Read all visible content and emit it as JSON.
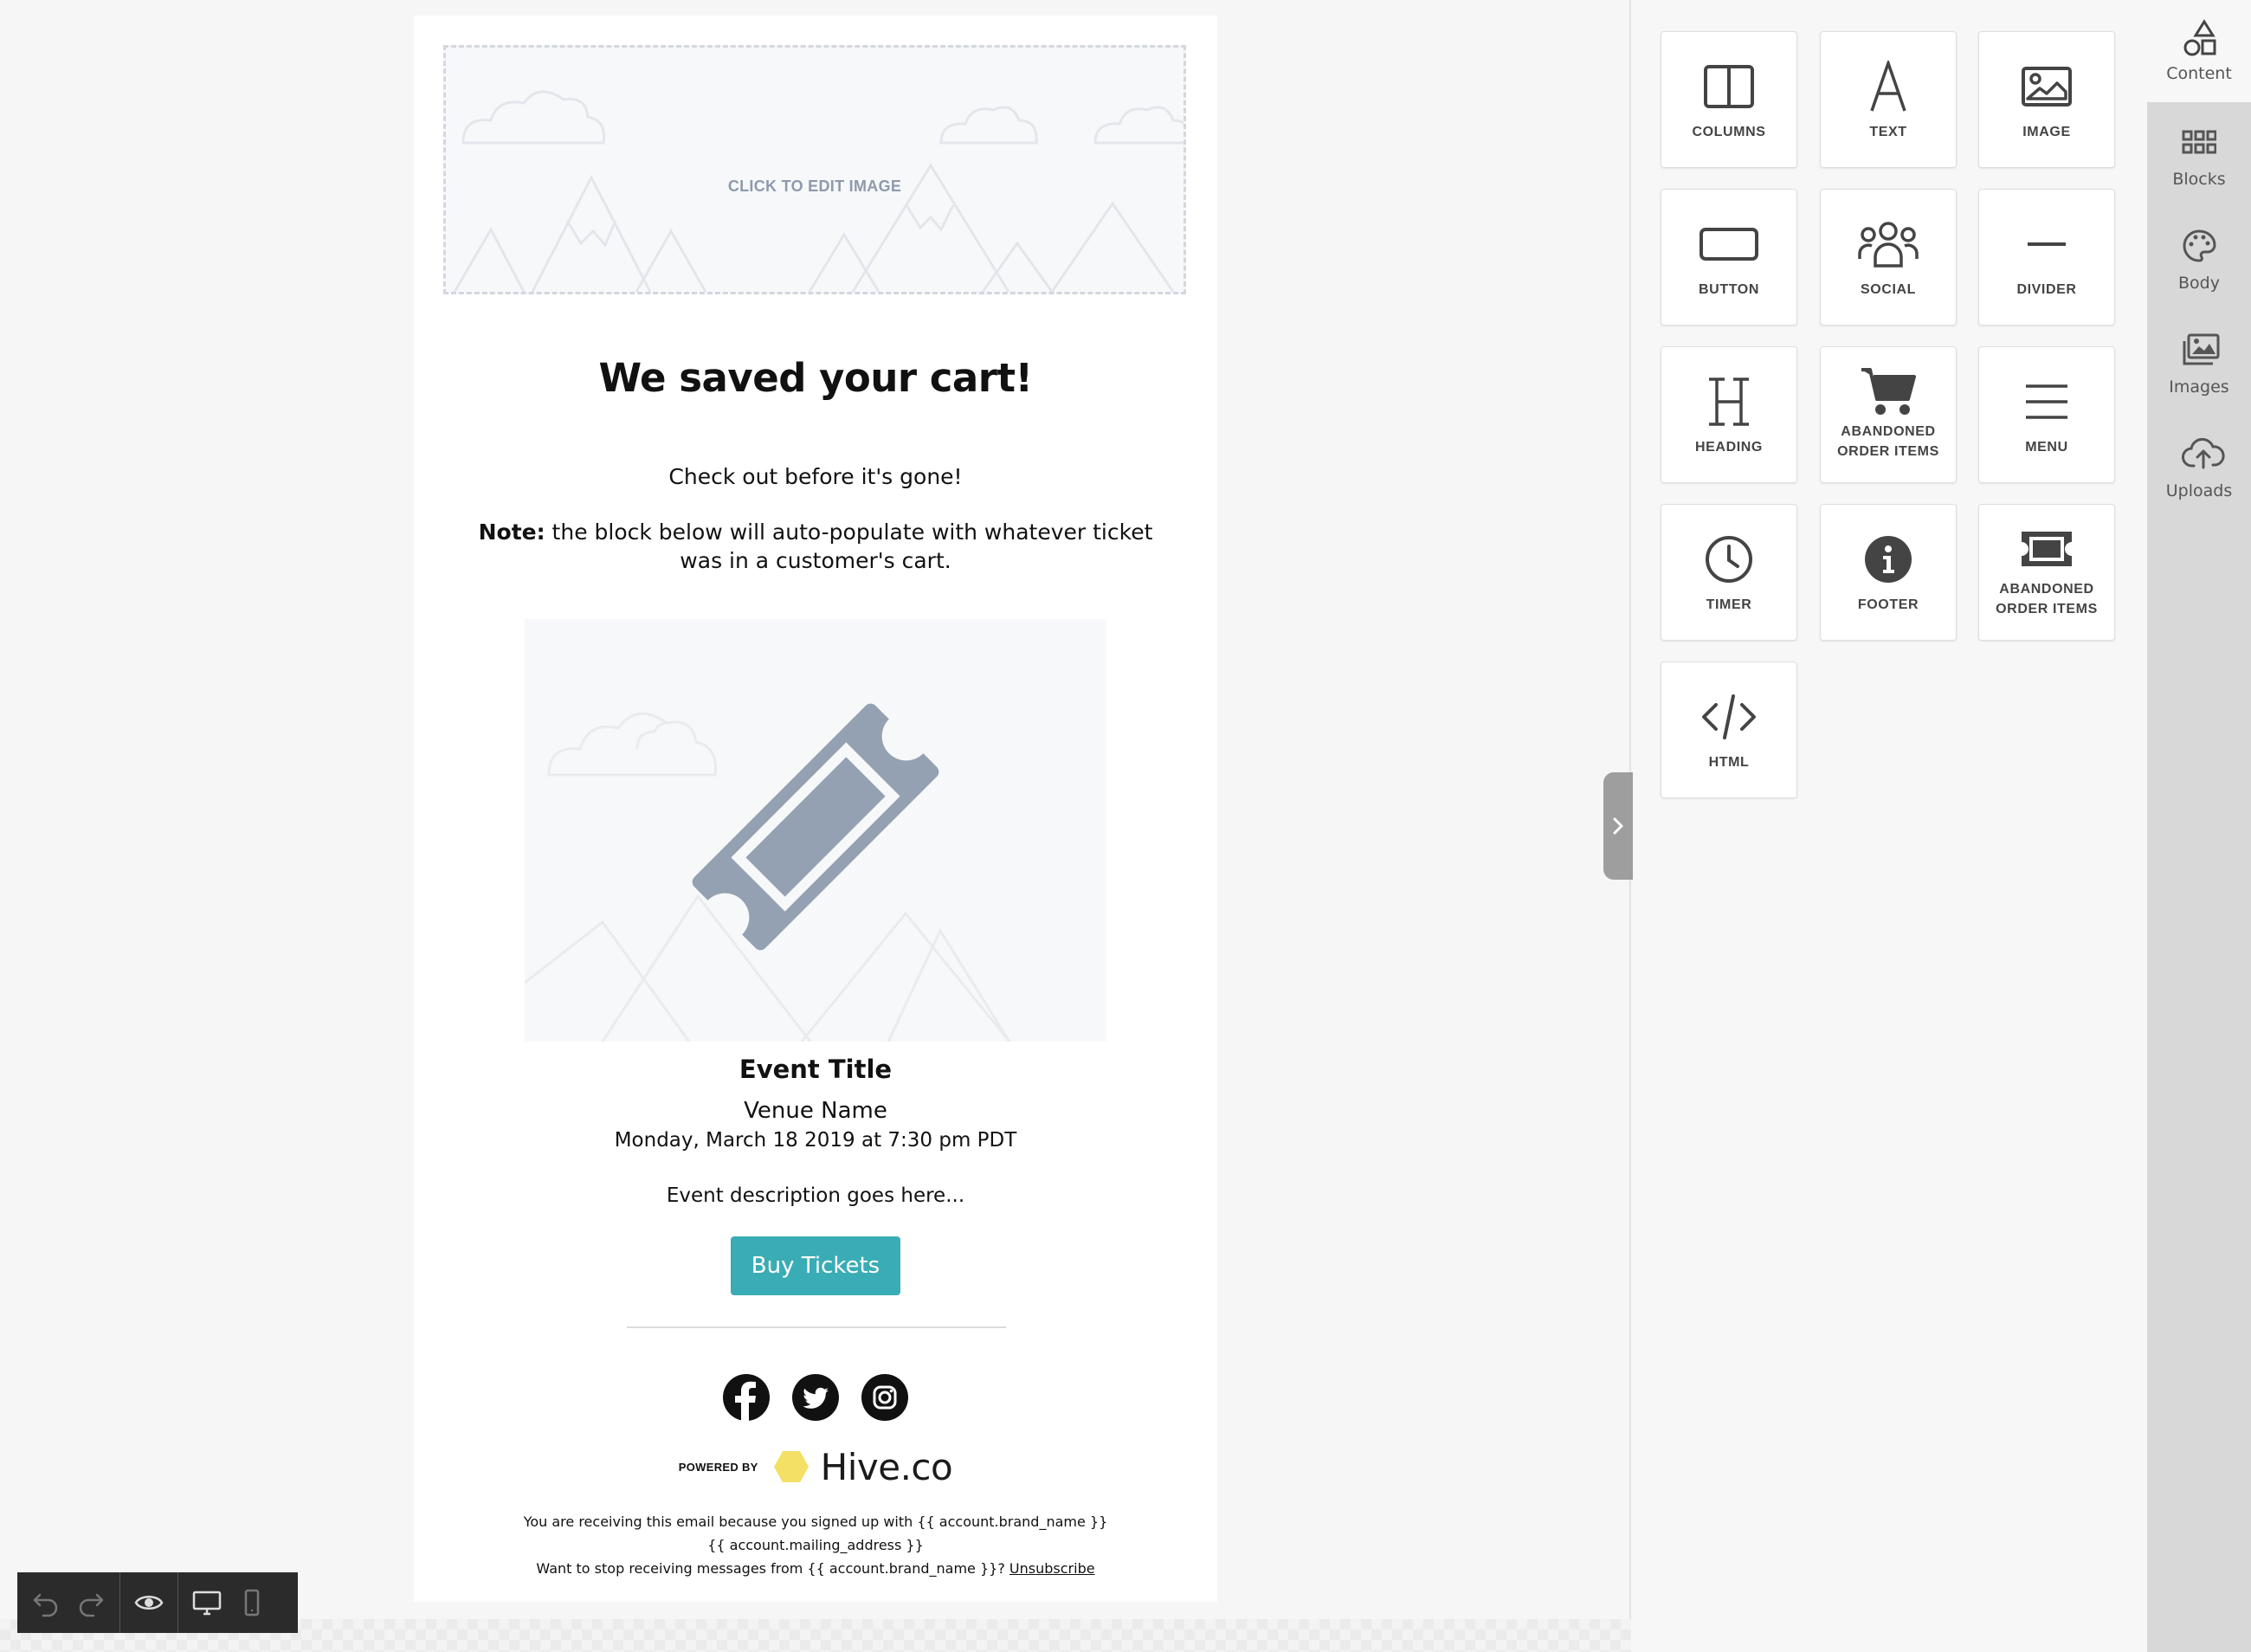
{
  "email": {
    "hero_placeholder_label": "CLICK TO EDIT IMAGE",
    "heading": "We saved your cart!",
    "subtext": "Check out before it's gone!",
    "note_bold": "Note:",
    "note_text": " the block below will auto-populate with whatever ticket was in a customer's cart.",
    "event_title": "Event Title",
    "venue_name": "Venue Name",
    "event_date": "Monday, March 18 2019 at 7:30 pm PDT",
    "event_description": "Event description goes here...",
    "buy_button_label": "Buy Tickets",
    "social_icons": [
      "facebook-icon",
      "twitter-icon",
      "instagram-icon"
    ],
    "powered_by_label": "POWERED BY",
    "brand_name": "Hive.co",
    "footer_line_1": "You are receiving this email because you signed up with {{ account.brand_name }}",
    "footer_line_2": "{{ account.mailing_address }}",
    "footer_line_3_prefix": "Want to stop receiving messages from {{ account.brand_name }}? ",
    "unsubscribe_label": "Unsubscribe"
  },
  "toolbar": {
    "icons": [
      "undo-icon",
      "redo-icon",
      "preview-eye-icon",
      "desktop-view-icon",
      "mobile-view-icon"
    ]
  },
  "content_tools": [
    {
      "label": "COLUMNS",
      "icon": "columns-icon"
    },
    {
      "label": "TEXT",
      "icon": "text-icon"
    },
    {
      "label": "IMAGE",
      "icon": "image-icon"
    },
    {
      "label": "BUTTON",
      "icon": "button-icon"
    },
    {
      "label": "SOCIAL",
      "icon": "social-icon"
    },
    {
      "label": "DIVIDER",
      "icon": "divider-icon"
    },
    {
      "label": "HEADING",
      "icon": "heading-icon"
    },
    {
      "label_line_1": "ABANDONED",
      "label_line_2": "ORDER ITEMS",
      "icon": "cart-icon"
    },
    {
      "label": "MENU",
      "icon": "menu-icon"
    },
    {
      "label": "TIMER",
      "icon": "clock-icon"
    },
    {
      "label": "FOOTER",
      "icon": "info-icon"
    },
    {
      "label_line_1": "ABANDONED",
      "label_line_2": "ORDER ITEMS",
      "icon": "ticket-icon"
    },
    {
      "label": "HTML",
      "icon": "code-icon"
    }
  ],
  "side_tabs": [
    {
      "label": "Content",
      "icon": "shapes-icon",
      "active": true
    },
    {
      "label": "Blocks",
      "icon": "grid-icon",
      "active": false
    },
    {
      "label": "Body",
      "icon": "palette-icon",
      "active": false
    },
    {
      "label": "Images",
      "icon": "images-icon",
      "active": false
    },
    {
      "label": "Uploads",
      "icon": "upload-cloud-icon",
      "active": false
    }
  ],
  "colors": {
    "button_teal": "#3aacb5",
    "ticket_gray": "#94a1b2",
    "hive_yellow": "#f5e066",
    "toolbar_dark": "#2b2b2b"
  }
}
